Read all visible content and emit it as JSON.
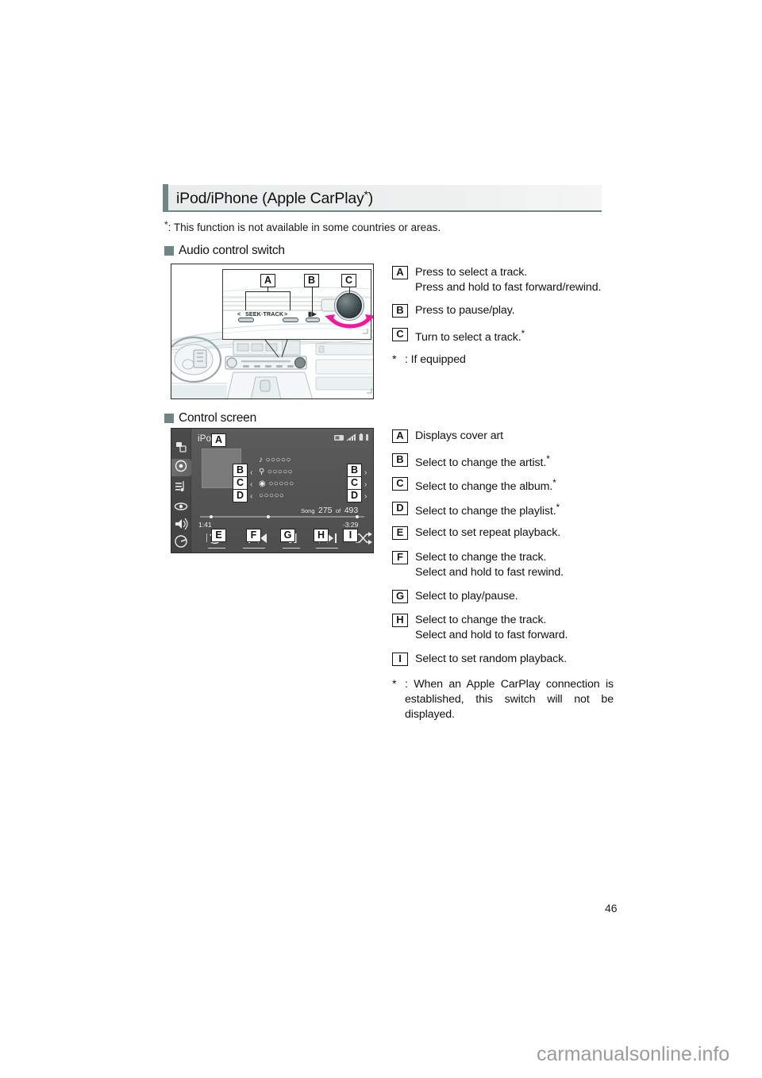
{
  "document": {
    "page_number": "46",
    "watermark": "carmanualsonline.info"
  },
  "section": {
    "title": "iPod/iPhone (Apple CarPlay",
    "title_star": "*",
    "title_close": ")",
    "footnote_mark": "*",
    "footnote": ": This function is not available in some countries or areas."
  },
  "audio_switch": {
    "heading": "Audio control switch",
    "illustration": {
      "name": "audio-control-switch-illustration",
      "seek_track_label": "SEEK·TRACK",
      "left_chevron": "<",
      "right_chevron": ">",
      "pause_play_glyph": "▶▐",
      "callout_tags": [
        "A",
        "B",
        "C"
      ]
    },
    "items": [
      {
        "tag": "A",
        "text": "Press to select a track.\nPress and hold to fast forward/rewind."
      },
      {
        "tag": "B",
        "text": "Press to pause/play."
      },
      {
        "tag": "C",
        "text": "Turn to select a track.",
        "star": "*"
      }
    ],
    "footnote_mark": "*",
    "footnote": ": If equipped"
  },
  "control_screen": {
    "heading": "Control screen",
    "screen": {
      "name": "ipod-control-screen",
      "title": "iPod",
      "song_label": "Song",
      "song_current": "275",
      "song_of": "of",
      "song_total": "493",
      "time_elapsed": "1:41",
      "time_remaining": "-3:29",
      "rail_icons": [
        "source-list-icon",
        "now-playing-icon",
        "track-list-icon",
        "display-icon",
        "volume-icon",
        "power-icon"
      ],
      "status_icons": [
        "phone-icon",
        "signal-icon",
        "battery-icon",
        "bar-icon"
      ],
      "meta_rows": [
        {
          "icon": "♪",
          "dots": "○○○○○"
        },
        {
          "icon": "⚲",
          "dots": "○○○○○"
        },
        {
          "icon": "◉",
          "dots": "○○○○○"
        },
        {
          "icon": "",
          "dots": "○○○○○"
        }
      ],
      "transport_icons": {
        "repeat": "repeat-icon",
        "previous": "previous-track-icon",
        "pause": "pause-icon",
        "next": "next-track-icon",
        "shuffle": "shuffle-icon"
      },
      "callout_tags": [
        "A",
        "B",
        "C",
        "D",
        "E",
        "F",
        "G",
        "H",
        "I"
      ]
    },
    "items": [
      {
        "tag": "A",
        "text": "Displays cover art"
      },
      {
        "tag": "B",
        "text": "Select to change the artist.",
        "star": "*"
      },
      {
        "tag": "C",
        "text": "Select to change the album.",
        "star": "*"
      },
      {
        "tag": "D",
        "text": "Select to change the playlist.",
        "star": "*"
      },
      {
        "tag": "E",
        "text": "Select to set repeat playback."
      },
      {
        "tag": "F",
        "text": "Select to change the track.\nSelect and hold to fast rewind."
      },
      {
        "tag": "G",
        "text": "Select to play/pause."
      },
      {
        "tag": "H",
        "text": "Select to change the track.\nSelect and hold to fast forward."
      },
      {
        "tag": "I",
        "text": "Select to set random playback."
      }
    ],
    "footnote_mark": "*",
    "footnote": ": When an Apple CarPlay connection is established, this switch will not be displayed."
  },
  "colors": {
    "accent": "#6f8487",
    "header_bg": "#eef0f0",
    "lcd_bg": "#555555",
    "arrow_highlight": "#f0189c"
  }
}
